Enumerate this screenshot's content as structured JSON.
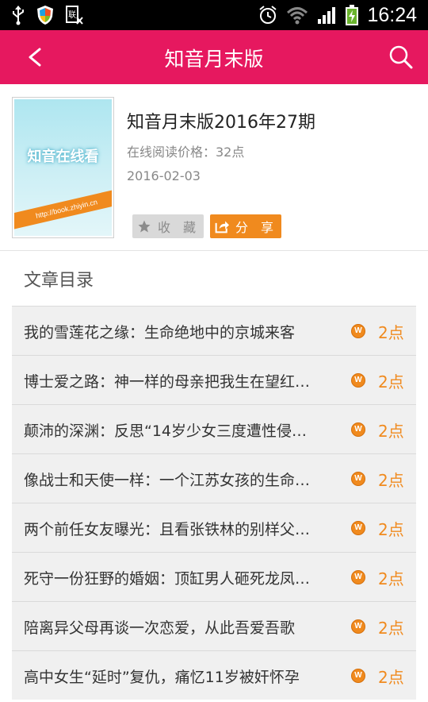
{
  "status_bar": {
    "time": "16:24",
    "icons": [
      "usb-icon",
      "shield-icon",
      "sim-icon",
      "alarm-icon",
      "wifi-icon",
      "signal-icon",
      "battery-charging-icon"
    ]
  },
  "app_bar": {
    "title": "知音月末版",
    "back_icon": "back-arrow-icon",
    "search_icon": "search-icon"
  },
  "book": {
    "title": "知音月末版2016年27期",
    "price": "在线阅读价格：32点",
    "date": "2016-02-03",
    "cover_logo": "知音在线看",
    "cover_url": "http://book.zhiyin.cn",
    "favorite_label": "收　藏",
    "share_label": "分　享"
  },
  "toc": {
    "title": "文章目录",
    "items": [
      {
        "title": "我的雪莲花之缘：生命绝地中的京城来客",
        "price": "2点"
      },
      {
        "title": "博士爱之路：神一样的母亲把我生在望红…",
        "price": "2点"
      },
      {
        "title": "颠沛的深渊：反思“14岁少女三度遭性侵…",
        "price": "2点"
      },
      {
        "title": "像战士和天使一样：一个江苏女孩的生命…",
        "price": "2点"
      },
      {
        "title": "两个前任女友曝光：且看张铁林的别样父…",
        "price": "2点"
      },
      {
        "title": "死守一份狂野的婚姻：顶缸男人砸死龙凤…",
        "price": "2点"
      },
      {
        "title": "陪离异父母再谈一次恋爱，从此吾爱吾歌",
        "price": "2点"
      },
      {
        "title": "高中女生“延时”复仇，痛忆11岁被奸怀孕",
        "price": "2点"
      }
    ]
  },
  "colors": {
    "app_bar": "#e6185f",
    "accent": "#f08a1e",
    "row_bg": "#f0f0f0"
  }
}
